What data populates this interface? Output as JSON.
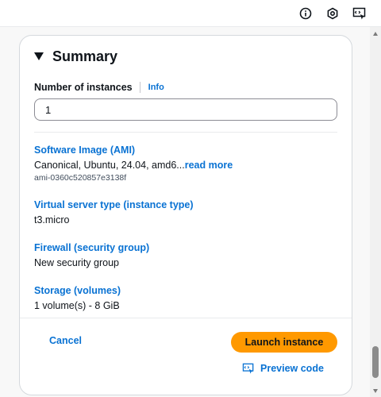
{
  "toolbar": {
    "icons": [
      "info-circle-icon",
      "settings-hexagon-icon",
      "preview-code-icon"
    ]
  },
  "summary": {
    "title": "Summary",
    "instances_label": "Number of instances",
    "info_link": "Info",
    "instances_value": "1",
    "sections": {
      "ami": {
        "title": "Software Image (AMI)",
        "value": "Canonical, Ubuntu, 24.04, amd6...",
        "read_more": "read more",
        "sub": "ami-0360c520857e3138f"
      },
      "instance_type": {
        "title": "Virtual server type (instance type)",
        "value": "t3.micro"
      },
      "firewall": {
        "title": "Firewall (security group)",
        "value": "New security group"
      },
      "storage": {
        "title": "Storage (volumes)",
        "value": "1 volume(s) - 8 GiB"
      }
    }
  },
  "actions": {
    "cancel": "Cancel",
    "launch": "Launch instance",
    "preview_code": "Preview code"
  },
  "colors": {
    "link": "#0972d3",
    "primary_button": "#ff9900",
    "text": "#0f141a",
    "border": "#d5d9dd"
  }
}
